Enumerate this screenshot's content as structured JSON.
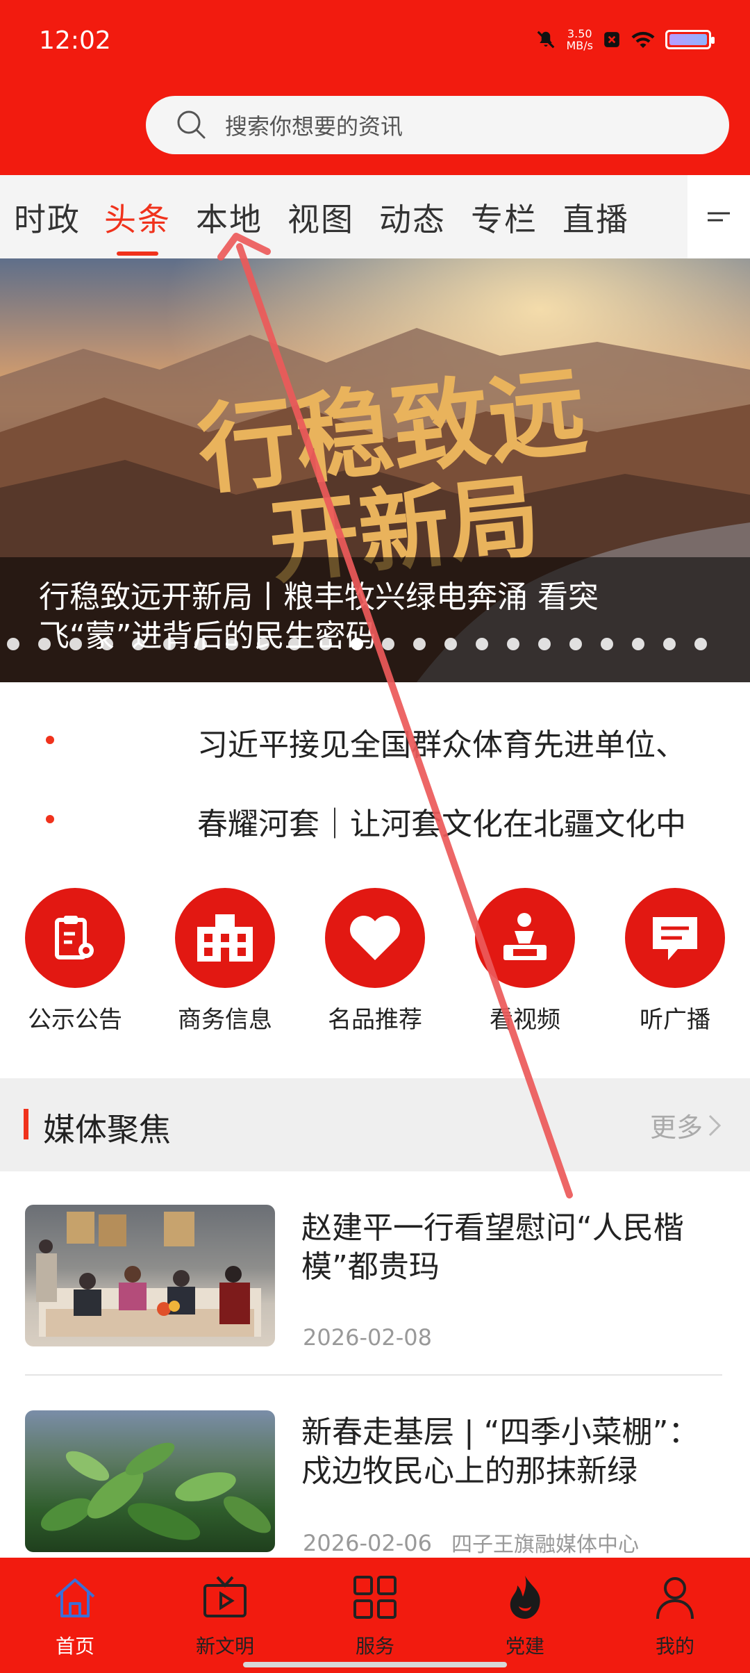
{
  "status_bar": {
    "time": "12:02",
    "net_speed_value": "3.50",
    "net_speed_unit": "MB/s",
    "icons": [
      "mute-icon",
      "notification-icon",
      "wifi-icon",
      "battery-icon"
    ]
  },
  "search": {
    "placeholder": "搜索你想要的资讯"
  },
  "tabs": [
    {
      "label": "时政"
    },
    {
      "label": "头条",
      "active": true
    },
    {
      "label": "本地"
    },
    {
      "label": "视图"
    },
    {
      "label": "动态"
    },
    {
      "label": "专栏"
    },
    {
      "label": "直播"
    }
  ],
  "banner": {
    "art_text_line1": "行稳致远",
    "art_text_line2": "开新局",
    "caption": "行稳致远开新局丨粮丰牧兴绿电奔涌 看突飞“蒙”进背后的民生密码",
    "slide_count": 23,
    "active_slide_index": 11
  },
  "headlines": [
    {
      "text": "习近平接见全国群众体育先进单位、"
    },
    {
      "text": "春耀河套｜让河套文化在北疆文化中"
    }
  ],
  "shortcuts": [
    {
      "label": "公示公告",
      "icon": "clipboard-search-icon"
    },
    {
      "label": "商务信息",
      "icon": "building-icon"
    },
    {
      "label": "名品推荐",
      "icon": "heart-icon"
    },
    {
      "label": "看视频",
      "icon": "video-person-icon"
    },
    {
      "label": "听广播",
      "icon": "chat-bubble-icon"
    }
  ],
  "section": {
    "title": "媒体聚焦",
    "more_label": "更多"
  },
  "news": [
    {
      "title": "赵建平一行看望慰问“人民楷模”都贵玛",
      "date": "2026-02-08",
      "source": ""
    },
    {
      "title": "新春走基层 | “四季小菜棚”：戍边牧民心上的那抹新绿",
      "date": "2026-02-06",
      "source": "四子王旗融媒体中心"
    }
  ],
  "bottom_nav": [
    {
      "label": "首页",
      "icon": "home-icon",
      "active": true
    },
    {
      "label": "新文明",
      "icon": "tv-icon"
    },
    {
      "label": "服务",
      "icon": "grid-icon"
    },
    {
      "label": "党建",
      "icon": "flame-icon"
    },
    {
      "label": "我的",
      "icon": "user-icon"
    }
  ],
  "colors": {
    "brand_red": "#f21b0f",
    "accent_red": "#f0321c",
    "annotation_arrow": "#ec5a5a"
  }
}
